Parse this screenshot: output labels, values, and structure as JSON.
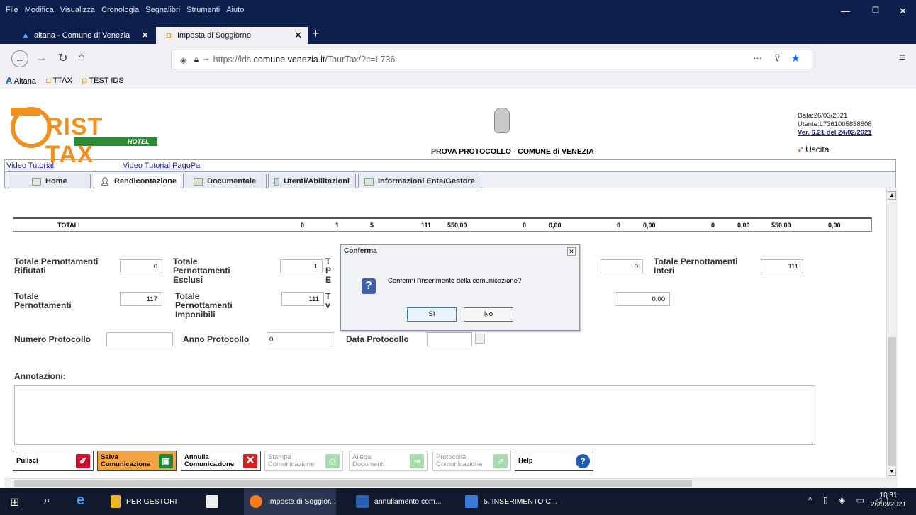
{
  "browser": {
    "menu": [
      "File",
      "Modifica",
      "Visualizza",
      "Cronologia",
      "Segnalibri",
      "Strumenti",
      "Aiuto"
    ],
    "tabs": [
      {
        "label": "altana - Comune di Venezia",
        "active": false
      },
      {
        "label": "Imposta di Soggiorno",
        "active": true
      }
    ],
    "url_prefix": "https://ids.",
    "url_domain": "comune.venezia.it",
    "url_path": "/TourTax/?c=L736",
    "bookmarks": [
      "Altana",
      "TTAX",
      "TEST IDS"
    ]
  },
  "header": {
    "logo_text": "RIST TAX",
    "logo_sub": "HOTEL",
    "title": "PROVA PROTOCOLLO - COMUNE di VENEZIA",
    "data": "Data:26/03/2021",
    "utente": "Utente:L7361005838808",
    "version": "Ver. 6.21 del 24/02/2021",
    "logout": "Uscita"
  },
  "links": {
    "video_tutorial": "Video Tutorial",
    "video_pagopa": "Video Tutorial PagoPa"
  },
  "app_tabs": [
    "Home",
    "Rendicontazione",
    "Documentale",
    "Utenti/Abilitazioni",
    "Informazioni Ente/Gestore"
  ],
  "totals": {
    "label": "TOTALI",
    "values": [
      "0",
      "1",
      "5",
      "111",
      "550,00",
      "0",
      "0,00",
      "0",
      "0,00",
      "0",
      "0,00",
      "550,00",
      "0,00"
    ]
  },
  "form": {
    "rifiutati_label": "Totale Pernottamenti Rifiutati",
    "rifiutati_value": "0",
    "esclusi_label": "Totale Pernottamenti Esclusi",
    "esclusi_value": "1",
    "totale_label": "Totale Pernottamenti",
    "totale_value": "117",
    "imponibili_label": "Totale Pernottamenti Imponibili",
    "imponibili_value": "111",
    "hidden_value": "0",
    "interi_label": "Totale Pernottamenti Interi",
    "interi_value": "111",
    "amount_value": "0,00",
    "numero_label": "Numero Protocollo",
    "numero_value": "",
    "anno_label": "Anno Protocollo",
    "anno_value": "0",
    "data_label": "Data Protocollo",
    "data_value": "",
    "annotazioni_label": "Annotazioni:"
  },
  "dialog": {
    "title": "Conferma",
    "message": "Confermi l'inserimento della comunicazione?",
    "yes": "Sì",
    "no": "No"
  },
  "toolbar": {
    "pulisci": "Pulisci",
    "salva1": "Salva",
    "salva2": "Comunicazione",
    "annulla1": "Annulla",
    "annulla2": "Comunicazione",
    "stampa1": "Stampa",
    "stampa2": "Comunicazione",
    "allega1": "Allega",
    "allega2": "Documenti",
    "protocolla1": "Protocolla",
    "protocolla2": "Comunicazione",
    "help": "Help"
  },
  "taskbar": {
    "items": [
      "PER GESTORI",
      "Imposta di Soggior...",
      "annullamento com...",
      "5. INSERIMENTO C..."
    ],
    "time": "10:31",
    "date": "26/03/2021"
  }
}
